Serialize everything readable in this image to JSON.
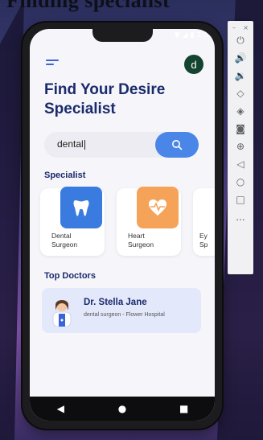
{
  "page_heading": "Finding specialist",
  "status": {
    "time_partial": "1:5"
  },
  "header": {
    "avatar_letter": "d"
  },
  "title": "Find Your Desire Specialist",
  "search": {
    "value": "dental"
  },
  "specialist_section": "Specialist",
  "specialists": [
    {
      "label_line1": "Dental",
      "label_line2": "Surgeon",
      "color": "#3a7be0",
      "icon": "tooth-icon"
    },
    {
      "label_line1": "Heart",
      "label_line2": "Surgeon",
      "color": "#f6a35a",
      "icon": "heart-pulse-icon"
    },
    {
      "label_line1": "Ey",
      "label_line2": "Sp",
      "color": "#e7894a",
      "icon": "eye-icon"
    }
  ],
  "top_doctors_section": "Top Doctors",
  "doctor": {
    "name": "Dr. Stella Jane",
    "description": "dental surgeon - Flower Hospital"
  },
  "emulator_toolbar": {
    "minimize": "–",
    "close": "×",
    "more": "..."
  }
}
